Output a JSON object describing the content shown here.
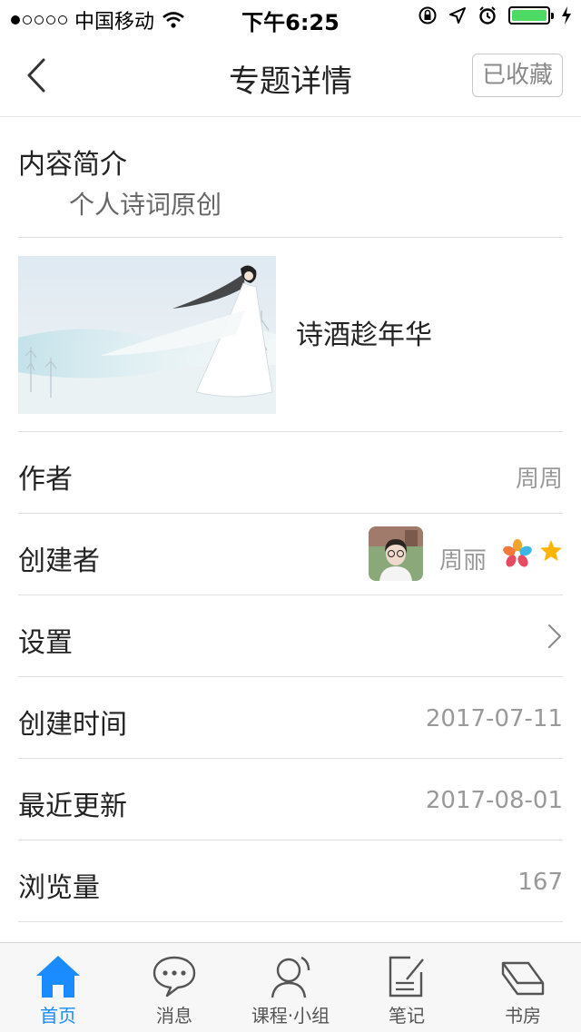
{
  "status_bar": {
    "carrier": "中国移动",
    "time": "下午6:25",
    "signal_dots_filled": 1,
    "signal_dots_total": 5,
    "battery_color": "#4cd964"
  },
  "nav": {
    "title": "专题详情",
    "favorite_label": "已收藏",
    "back_icon": "chevron-left-icon"
  },
  "intro": {
    "heading": "内容简介",
    "text": "个人诗词原创"
  },
  "cover": {
    "title": "诗酒趁年华"
  },
  "rows": {
    "author": {
      "label": "作者",
      "value": "周周"
    },
    "creator": {
      "label": "创建者",
      "name": "周丽"
    },
    "settings": {
      "label": "设置"
    },
    "created": {
      "label": "创建时间",
      "value": "2017-07-11"
    },
    "updated": {
      "label": "最近更新",
      "value": "2017-08-01"
    },
    "views": {
      "label": "浏览量",
      "value": "167"
    }
  },
  "tabs": [
    {
      "label": "首页",
      "icon": "home-icon",
      "active": true
    },
    {
      "label": "消息",
      "icon": "chat-bubble-icon",
      "active": false
    },
    {
      "label": "课程·小组",
      "icon": "person-icon",
      "active": false
    },
    {
      "label": "笔记",
      "icon": "note-icon",
      "active": false
    },
    {
      "label": "书房",
      "icon": "books-icon",
      "active": false
    }
  ],
  "colors": {
    "accent": "#1a8cff",
    "muted_text": "#999999",
    "star": "#ffb400"
  }
}
